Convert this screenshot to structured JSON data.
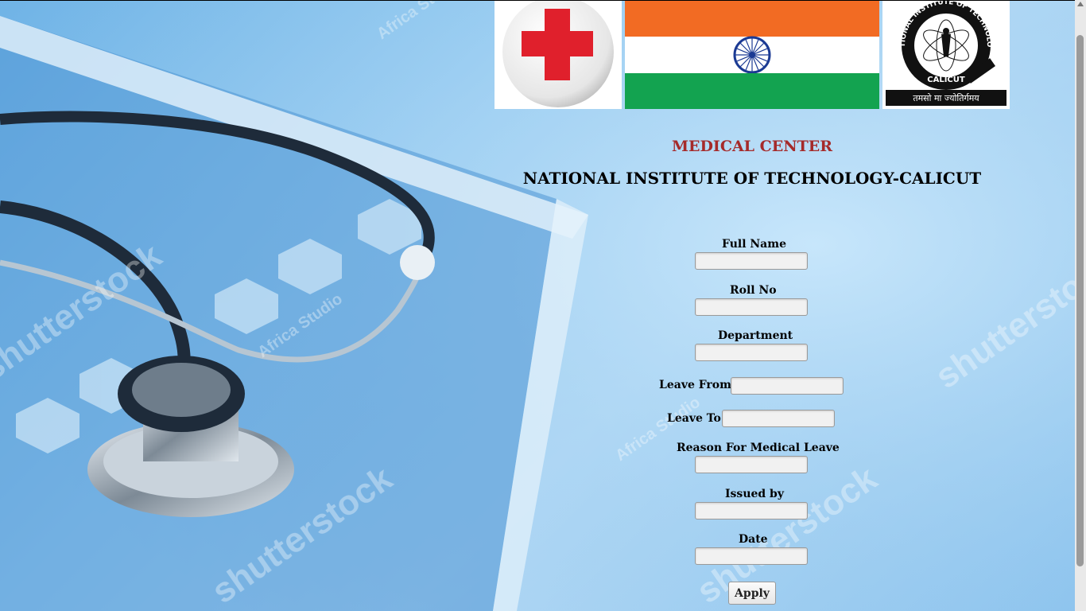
{
  "header": {
    "title_line1": "MEDICAL CENTER",
    "title_line2": "NATIONAL INSTITUTE OF TECHNOLOGY-CALICUT"
  },
  "logos": {
    "nit_ring_text": "NATIONAL INSTITUTE OF TECHNOLOGY",
    "nit_bottom_text": "CALICUT",
    "nit_motto": "तमसो मा ज्योतिर्गमय"
  },
  "form": {
    "full_name_label": "Full Name",
    "roll_no_label": "Roll No",
    "department_label": "Department",
    "leave_from_label": "Leave From",
    "leave_to_label": "Leave To",
    "reason_label": "Reason For Medical Leave",
    "issued_by_label": "Issued by",
    "date_label": "Date",
    "apply_label": "Apply",
    "full_name_value": "",
    "roll_no_value": "",
    "department_value": "",
    "leave_from_value": "",
    "leave_to_value": "",
    "reason_value": "",
    "issued_by_value": "",
    "date_value": ""
  },
  "watermark": {
    "text1": "shutterstock",
    "text2": "Africa Studio"
  },
  "colors": {
    "title_red": "#a52a2a",
    "cross_red": "#e0202c",
    "flag_saffron": "#f26b23",
    "flag_green": "#13a350",
    "chakra_blue": "#1b3a93"
  }
}
